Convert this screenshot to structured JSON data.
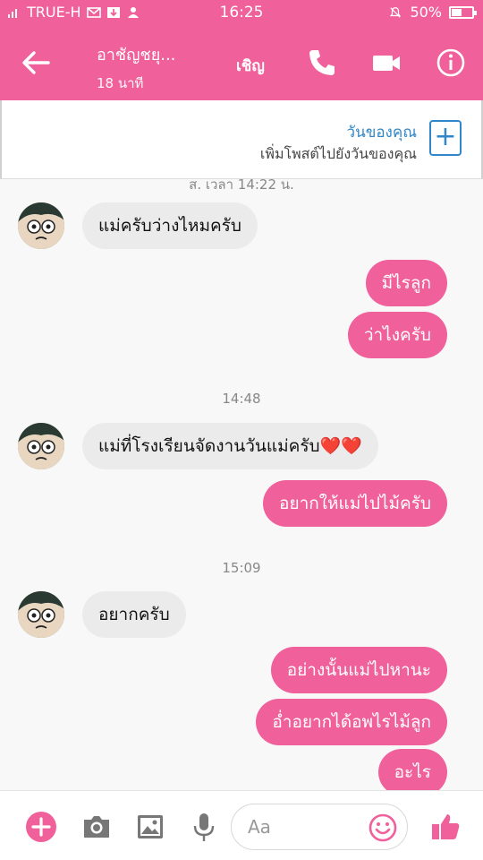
{
  "status": {
    "carrier": "TRUE-H",
    "time": "16:25",
    "battery": "50%",
    "battery_level": 0.5
  },
  "header": {
    "title": "อาชัญชยุ...",
    "subtitle": "18 นาที",
    "invite_label": "เชิญ",
    "accent": "#f0609a"
  },
  "banner": {
    "title": "วันของคุณ",
    "subtitle": "เพิ่มโพสต์ไปยังวันของคุณ",
    "add_symbol": "+"
  },
  "messages": {
    "timestamp_partial": "ส. เวลา 14:22 น.",
    "incoming_1": "แม่ครับว่างไหมครับ",
    "outgoing_1": "มีไรลูก",
    "outgoing_2": "ว่าไงครับ",
    "timestamp_1": "14:48",
    "incoming_2": "แม่ที่โรงเรียนจัดงานวันแม่ครับ❤️❤️",
    "outgoing_3": "อยากให้แม่ไปไม้ครับ",
    "timestamp_2": "15:09",
    "incoming_3": "อยากครับ",
    "outgoing_4": "อย่างนั้นแม่ไปหานะ",
    "outgoing_5": "อ่ำอยากได้อพไรไม้ลูก",
    "outgoing_6": "อะไร"
  },
  "composer": {
    "placeholder": "Aa"
  },
  "icons": [
    "back-arrow-icon",
    "phone-icon",
    "video-camera-icon",
    "info-icon",
    "plus-icon",
    "camera-icon",
    "gallery-icon",
    "microphone-icon",
    "emoji-icon",
    "thumbs-up-icon"
  ]
}
